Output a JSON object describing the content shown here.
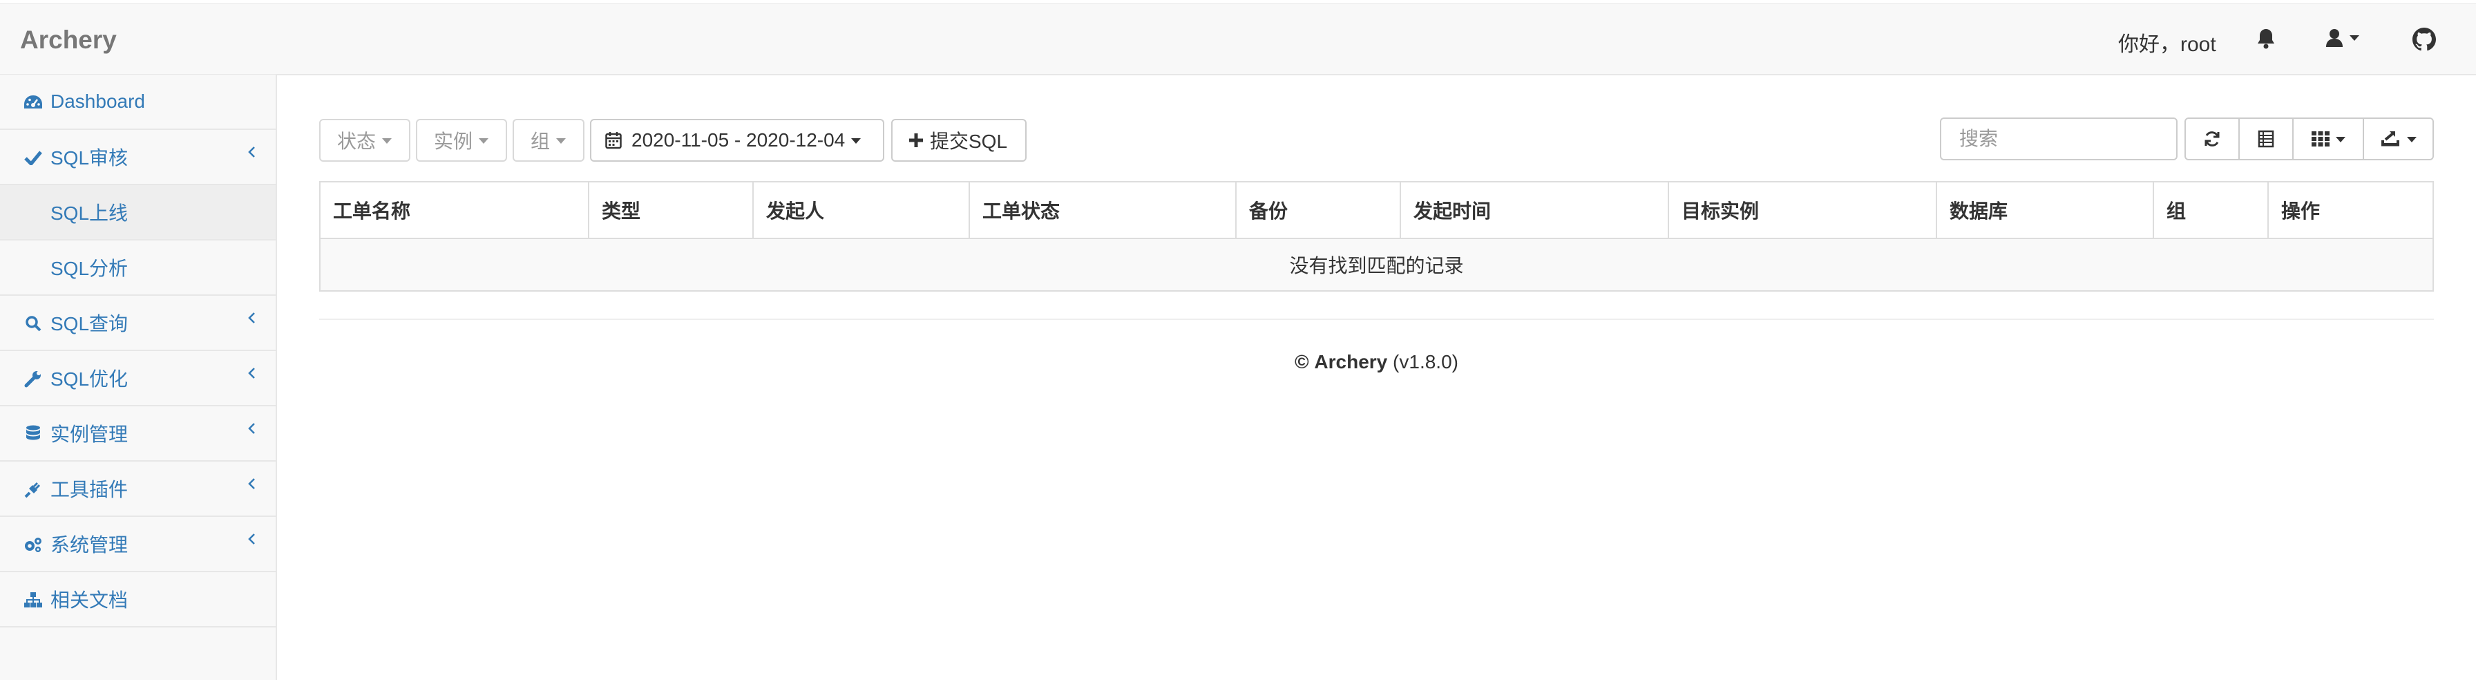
{
  "app": {
    "brand": "Archery"
  },
  "header": {
    "greeting": "你好，root",
    "icons": [
      "bell-icon",
      "user-icon",
      "github-icon"
    ]
  },
  "sidebar": {
    "items": [
      {
        "label": "Dashboard",
        "icon": "dashboard-icon",
        "expandable": false
      },
      {
        "label": "SQL审核",
        "icon": "check-icon",
        "expandable": true,
        "expanded": true
      },
      {
        "label": "SQL上线",
        "icon": "",
        "sub": true,
        "active": true
      },
      {
        "label": "SQL分析",
        "icon": "",
        "sub": true
      },
      {
        "label": "SQL查询",
        "icon": "search-icon",
        "expandable": true
      },
      {
        "label": "SQL优化",
        "icon": "wrench-icon",
        "expandable": true
      },
      {
        "label": "实例管理",
        "icon": "database-icon",
        "expandable": true
      },
      {
        "label": "工具插件",
        "icon": "plug-icon",
        "expandable": true
      },
      {
        "label": "系统管理",
        "icon": "gears-icon",
        "expandable": true
      },
      {
        "label": "相关文档",
        "icon": "sitemap-icon",
        "expandable": false
      }
    ]
  },
  "toolbar": {
    "status_filter": "状态",
    "instance_filter": "实例",
    "group_filter": "组",
    "date_range": "2020-11-05 - 2020-12-04",
    "submit_label": "提交SQL",
    "search_placeholder": "搜索",
    "right_buttons": [
      "refresh-icon",
      "toggle-view-icon",
      "columns-icon",
      "export-icon"
    ]
  },
  "table": {
    "columns": [
      "工单名称",
      "类型",
      "发起人",
      "工单状态",
      "备份",
      "发起时间",
      "目标实例",
      "数据库",
      "组",
      "操作"
    ],
    "empty_message": "没有找到匹配的记录"
  },
  "footer": {
    "copyright_symbol": "©",
    "product": "Archery",
    "version": "(v1.8.0)"
  },
  "colors": {
    "link": "#337ab7",
    "navbar_bg": "#f8f8f8",
    "border": "#dddddd"
  }
}
